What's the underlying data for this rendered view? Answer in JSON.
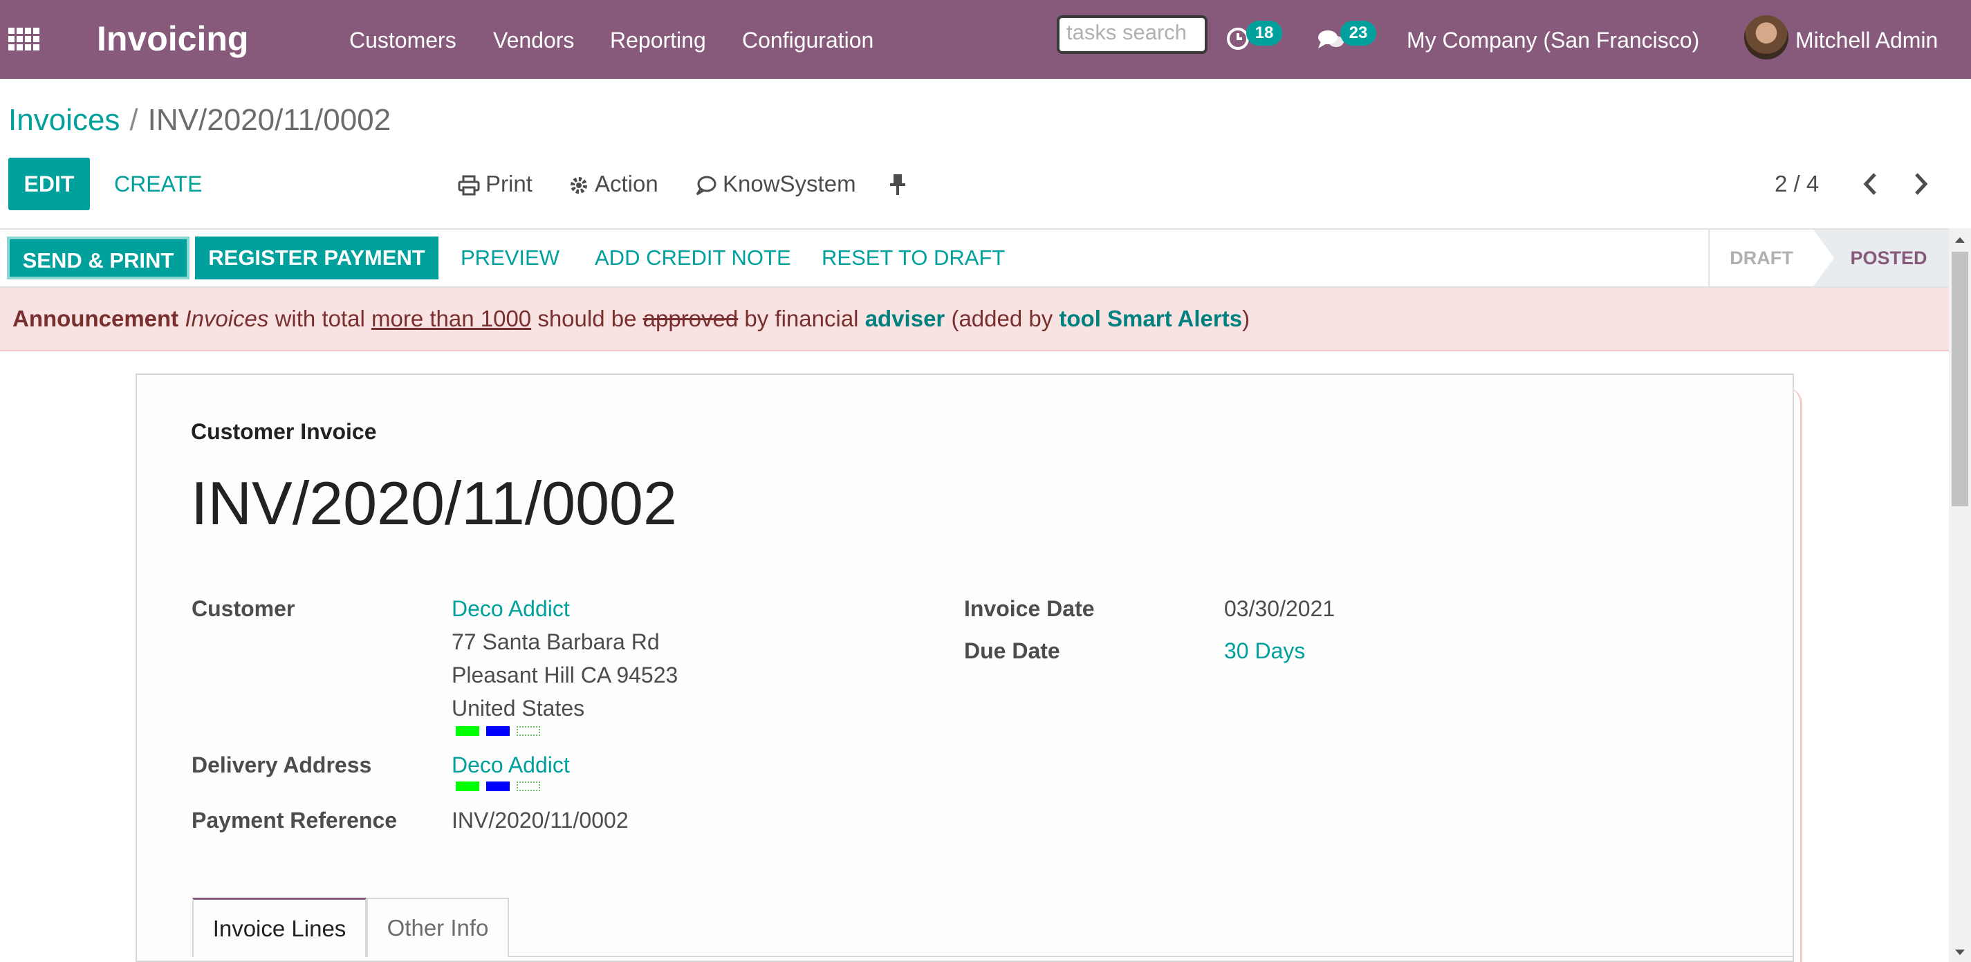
{
  "navbar": {
    "app_name": "Invoicing",
    "menu": [
      "Customers",
      "Vendors",
      "Reporting",
      "Configuration"
    ],
    "search_placeholder": "tasks search",
    "activity_count": "18",
    "message_count": "23",
    "company": "My Company (San Francisco)",
    "user": "Mitchell Admin",
    "icons": {
      "apps": "apps-grid-icon",
      "activity": "clock-icon",
      "messages": "chat-bubbles-icon"
    }
  },
  "breadcrumb": {
    "parent": "Invoices",
    "separator": "/",
    "current": "INV/2020/11/0002"
  },
  "toolbar": {
    "edit_label": "EDIT",
    "create_label": "CREATE",
    "print_label": "Print",
    "action_label": "Action",
    "knowsystem_label": "KnowSystem",
    "pager": "2 / 4"
  },
  "statusbar": {
    "buttons": [
      "SEND & PRINT",
      "REGISTER PAYMENT",
      "PREVIEW",
      "ADD CREDIT NOTE",
      "RESET TO DRAFT"
    ],
    "stages": [
      "DRAFT",
      "POSTED"
    ],
    "active_stage": "POSTED"
  },
  "announcement": {
    "title": "Announcement",
    "word_invoices": "Invoices",
    "text_with_total": "with total",
    "text_more_than": "more than 1000",
    "text_should_be": "should be",
    "text_approved": "approved",
    "text_by_financial": "by financial",
    "text_adviser": "adviser",
    "text_added_by": "(added by",
    "text_tool": "tool Smart Alerts",
    "text_close": ")"
  },
  "invoice": {
    "doc_type": "Customer Invoice",
    "number": "INV/2020/11/0002",
    "customer_label": "Customer",
    "customer_name": "Deco Addict",
    "address_line1": "77 Santa Barbara Rd",
    "address_line2": "Pleasant Hill CA 94523",
    "address_line3": "United States",
    "delivery_label": "Delivery Address",
    "delivery_name": "Deco Addict",
    "payment_ref_label": "Payment Reference",
    "payment_ref": "INV/2020/11/0002",
    "invoice_date_label": "Invoice Date",
    "invoice_date": "03/30/2021",
    "due_date_label": "Due Date",
    "due_date": "30 Days",
    "tag_colors": [
      "#00ff00",
      "#0000ff",
      "#ffffff"
    ]
  },
  "tabs": [
    "Invoice Lines",
    "Other Info"
  ],
  "colors": {
    "brand": "#875a7b",
    "accent": "#00a09d",
    "announcement_bg": "#f8e2e2"
  }
}
